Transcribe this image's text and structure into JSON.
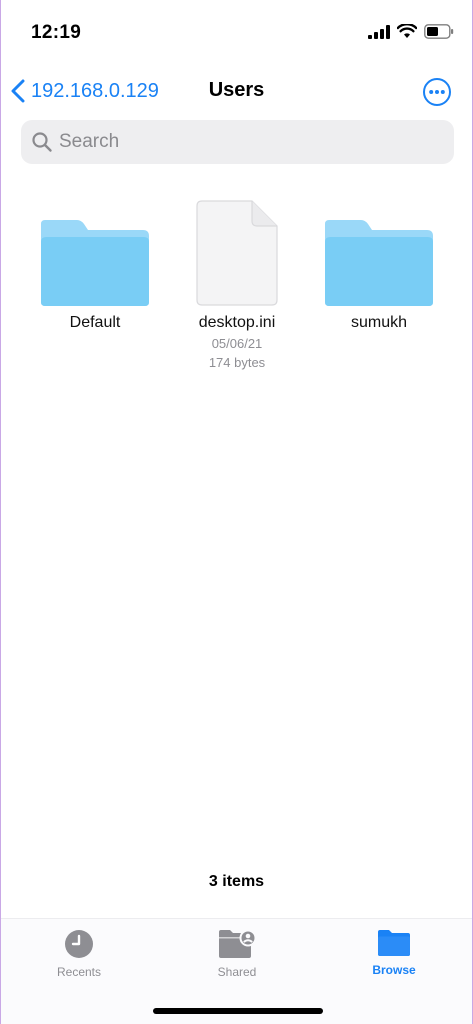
{
  "status_bar": {
    "time": "12:19",
    "icons": [
      "signal-icon",
      "wifi-icon",
      "battery-icon"
    ]
  },
  "nav": {
    "back_label": "192.168.0.129",
    "title": "Users",
    "more_icon": "ellipsis-circle-icon"
  },
  "search": {
    "placeholder": "Search",
    "value": ""
  },
  "files": [
    {
      "name": "Default",
      "kind": "folder"
    },
    {
      "name": "desktop.ini",
      "kind": "file",
      "date": "05/06/21",
      "size": "174 bytes"
    },
    {
      "name": "sumukh",
      "kind": "folder"
    }
  ],
  "item_count": "3 items",
  "tabs": [
    {
      "label": "Recents",
      "icon": "clock-icon",
      "active": false
    },
    {
      "label": "Shared",
      "icon": "shared-folder-icon",
      "active": false
    },
    {
      "label": "Browse",
      "icon": "folder-icon",
      "active": true
    }
  ],
  "colors": {
    "accent": "#1a82f5",
    "folder": "#79cdf5",
    "inactive": "#8e8e93"
  }
}
